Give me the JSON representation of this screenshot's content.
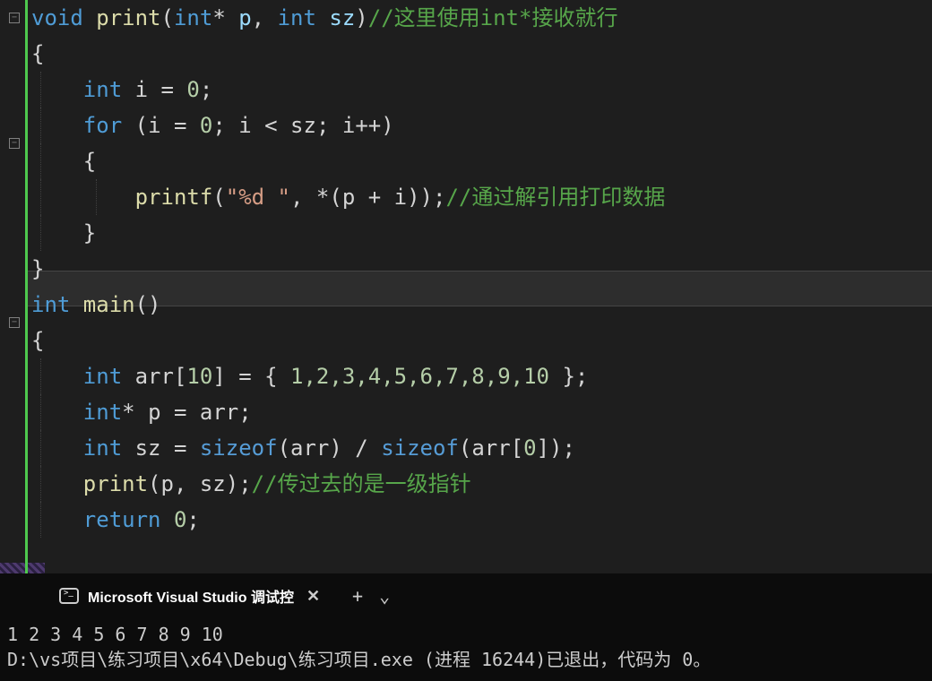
{
  "code": {
    "l1": {
      "kw1": "void",
      "fn": "print",
      "p": "(",
      "kw2": "int",
      "star": "* ",
      "param1": "p",
      "comma": ", ",
      "kw3": "int",
      "sp": " ",
      "param2": "sz",
      "cp": ")",
      "cmt": "//这里使用int*接收就行"
    },
    "l2": "{",
    "l3": {
      "kw": "int",
      "var": " i ",
      "eq": "= ",
      "num": "0",
      "semi": ";"
    },
    "l4": {
      "kw": "for",
      "open": " (",
      "v1": "i ",
      "eq": "= ",
      "n1": "0",
      "s1": "; ",
      "v2": "i ",
      "lt": "< ",
      "v3": "sz",
      "s2": "; ",
      "v4": "i",
      "pp": "++",
      ")": ")"
    },
    "l5": "{",
    "l6": {
      "fn": "printf",
      "open": "(",
      "str": "\"%d \"",
      "comma": ", ",
      "star": "*(",
      "v1": "p ",
      "plus": "+ ",
      "v2": "i",
      "close": "))",
      "semi": ";",
      "cmt": "//通过解引用打印数据"
    },
    "l7": "}",
    "l8": "}",
    "l9": {
      "kw": "int",
      "fn": " main",
      "p": "()"
    },
    "l10": "{",
    "l11": {
      "kw": "int",
      "var": " arr",
      "br": "[",
      "n": "10",
      "cb": "] ",
      "eq": "= { ",
      "nums": "1,2,3,4,5,6,7,8,9,10",
      "end": " };"
    },
    "l12": {
      "kw": "int",
      "star": "* ",
      "v1": "p ",
      "eq": "= ",
      "v2": "arr",
      "semi": ";"
    },
    "l13": {
      "kw": "int",
      "v1": " sz ",
      "eq": "= ",
      "sz1": "sizeof",
      "o1": "(",
      "v2": "arr",
      "c1": ") ",
      "div": "/ ",
      "sz2": "sizeof",
      "o2": "(",
      "v3": "arr",
      "br": "[",
      "n": "0",
      "cb": "])",
      "semi": ";"
    },
    "l14": {
      "fn": "print",
      "open": "(",
      "v1": "p",
      "comma": ", ",
      "v2": "sz",
      "close": ")",
      "semi": ";",
      "cmt": "//传过去的是一级指针"
    },
    "l15": {
      "kw": "return",
      "sp": " ",
      "n": "0",
      "semi": ";"
    }
  },
  "terminal": {
    "tab_title": "Microsoft Visual Studio 调试控",
    "output_line1": "1 2 3 4 5 6 7 8 9 10",
    "output_line2": "D:\\vs项目\\练习项目\\x64\\Debug\\练习项目.exe (进程 16244)已退出，代码为 0。",
    "add_btn": "+",
    "chevron": "⌄",
    "close": "✕"
  },
  "status_check": "✓"
}
